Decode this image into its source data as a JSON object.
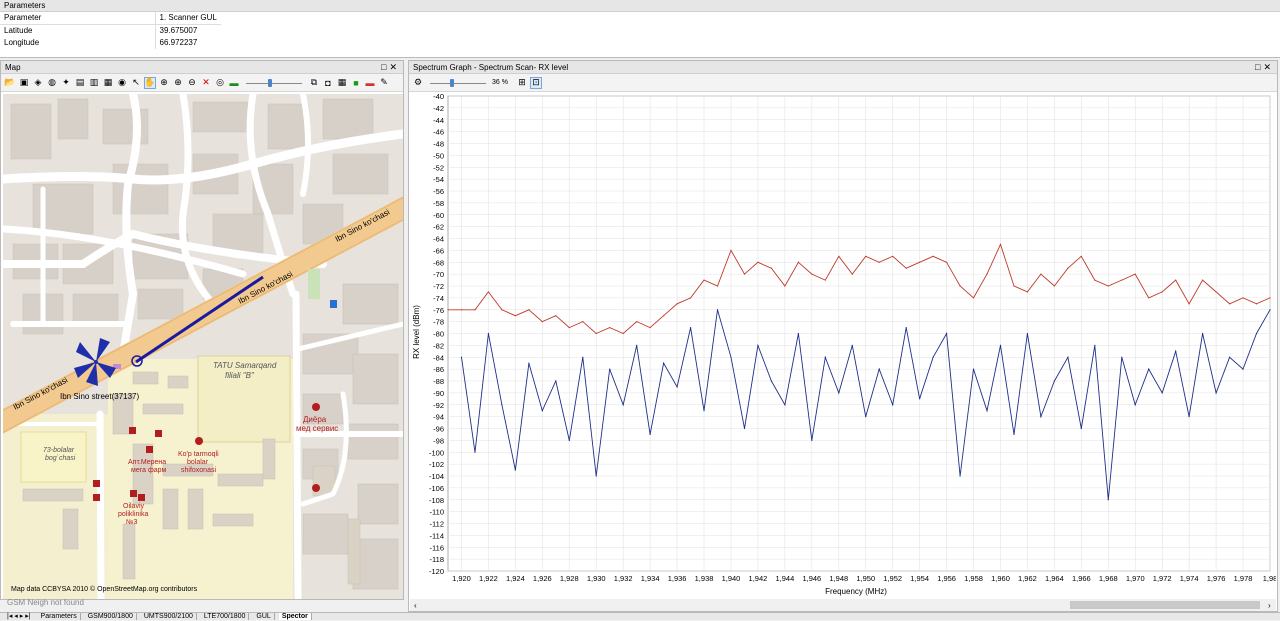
{
  "params": {
    "title": "Parameters",
    "header": [
      "Parameter",
      "1. Scanner GUL"
    ],
    "rows": [
      {
        "name": "Latitude",
        "value": "39.675007"
      },
      {
        "name": "Longitude",
        "value": "66.972237"
      }
    ]
  },
  "map": {
    "title": "Map",
    "attribution": "Map data CCBYSA 2010 © OpenStreetMap.org contributors",
    "labels": {
      "street1": "Ibn Sino ko'chasi",
      "street2": "Ibn Sino ko'chasi",
      "street3": "Ibn Sino ko'chasi",
      "street_id": "Ibn Sino street(37137)",
      "tatu1": "TATU Samarqand",
      "tatu2": "filiali \"B\"",
      "diera1": "Диёра",
      "diera2": "мед сервис",
      "park1": "73-bolalar",
      "park2": "bog`chasi",
      "apt1": "Апт.Мерена",
      "apt2": "мега фарм",
      "kop1": "Ko'p tarmoqli",
      "kop2": "bolalar",
      "kop3": "shifoxonasi",
      "oilaviy1": "Oilaviy",
      "oilaviy2": "poliklinika",
      "oilaviy3": "№3"
    }
  },
  "spectrum": {
    "title": "Spectrum Graph - Spectrum Scan- RX level",
    "zoom": "36 %"
  },
  "status": "GSM Neigh not found",
  "tabs": [
    "Parameters",
    "GSM900/1800",
    "UMTS900/2100",
    "LTE700/1800",
    "GUL",
    "Spector"
  ],
  "active_tab": "Spector",
  "chart_data": {
    "type": "line",
    "xlabel": "Frequency (MHz)",
    "ylabel": "RX level (dBm)",
    "xlim": [
      1919,
      1980
    ],
    "ylim": [
      -120,
      -40
    ],
    "x_ticks": [
      "1,920",
      "1,922",
      "1,924",
      "1,926",
      "1,928",
      "1,930",
      "1,932",
      "1,934",
      "1,936",
      "1,938",
      "1,940",
      "1,942",
      "1,944",
      "1,946",
      "1,948",
      "1,950",
      "1,952",
      "1,954",
      "1,956",
      "1,958",
      "1,960",
      "1,962",
      "1,964",
      "1,966",
      "1,968",
      "1,970",
      "1,972",
      "1,974",
      "1,976",
      "1,978",
      "1,98"
    ],
    "y_ticks": [
      "-40",
      "-42",
      "-44",
      "-46",
      "-48",
      "-50",
      "-52",
      "-54",
      "-56",
      "-58",
      "-60",
      "-62",
      "-64",
      "-66",
      "-68",
      "-70",
      "-72",
      "-74",
      "-76",
      "-78",
      "-80",
      "-82",
      "-84",
      "-86",
      "-88",
      "-90",
      "-92",
      "-94",
      "-96",
      "-98",
      "-100",
      "-102",
      "-104",
      "-106",
      "-108",
      "-110",
      "-112",
      "-114",
      "-116",
      "-118",
      "-120"
    ],
    "grid": true,
    "series": [
      {
        "color": "#c0392b",
        "x": [
          1919,
          1920,
          1921,
          1922,
          1923,
          1924,
          1925,
          1926,
          1927,
          1928,
          1929,
          1930,
          1931,
          1932,
          1933,
          1934,
          1935,
          1936,
          1937,
          1938,
          1939,
          1940,
          1941,
          1942,
          1943,
          1944,
          1945,
          1946,
          1947,
          1948,
          1949,
          1950,
          1951,
          1952,
          1953,
          1954,
          1955,
          1956,
          1957,
          1958,
          1959,
          1960,
          1961,
          1962,
          1963,
          1964,
          1965,
          1966,
          1967,
          1968,
          1969,
          1970,
          1971,
          1972,
          1973,
          1974,
          1975,
          1976,
          1977,
          1978,
          1979,
          1980
        ],
        "values": [
          -76,
          -76,
          -76,
          -73,
          -76,
          -77,
          -76,
          -78,
          -77,
          -79,
          -78,
          -80,
          -79,
          -80,
          -78,
          -79,
          -77,
          -75,
          -74,
          -71,
          -72,
          -66,
          -70,
          -68,
          -69,
          -72,
          -68,
          -70,
          -71,
          -67,
          -70,
          -67,
          -68,
          -67,
          -69,
          -68,
          -67,
          -68,
          -72,
          -74,
          -70,
          -65,
          -72,
          -73,
          -70,
          -72,
          -69,
          -67,
          -71,
          -72,
          -71,
          -70,
          -74,
          -73,
          -71,
          -75,
          -71,
          -73,
          -75,
          -74,
          -75,
          -74
        ]
      },
      {
        "color": "#1f2f8a",
        "x": [
          1920,
          1921,
          1922,
          1923,
          1924,
          1925,
          1926,
          1927,
          1928,
          1929,
          1930,
          1931,
          1932,
          1933,
          1934,
          1935,
          1936,
          1937,
          1938,
          1939,
          1940,
          1941,
          1942,
          1943,
          1944,
          1945,
          1946,
          1947,
          1948,
          1949,
          1950,
          1951,
          1952,
          1953,
          1954,
          1955,
          1956,
          1957,
          1958,
          1959,
          1960,
          1961,
          1962,
          1963,
          1964,
          1965,
          1966,
          1967,
          1968,
          1969,
          1970,
          1971,
          1972,
          1973,
          1974,
          1975,
          1976,
          1977,
          1978,
          1979,
          1980
        ],
        "values": [
          -84,
          -100,
          -80,
          -92,
          -103,
          -85,
          -93,
          -88,
          -98,
          -84,
          -104,
          -86,
          -92,
          -82,
          -97,
          -85,
          -89,
          -79,
          -93,
          -76,
          -84,
          -96,
          -82,
          -88,
          -92,
          -80,
          -98,
          -84,
          -90,
          -82,
          -94,
          -86,
          -92,
          -79,
          -91,
          -84,
          -80,
          -104,
          -86,
          -93,
          -82,
          -97,
          -80,
          -94,
          -88,
          -84,
          -96,
          -82,
          -108,
          -84,
          -92,
          -86,
          -90,
          -83,
          -94,
          -80,
          -90,
          -84,
          -86,
          -80,
          -76
        ]
      }
    ]
  }
}
